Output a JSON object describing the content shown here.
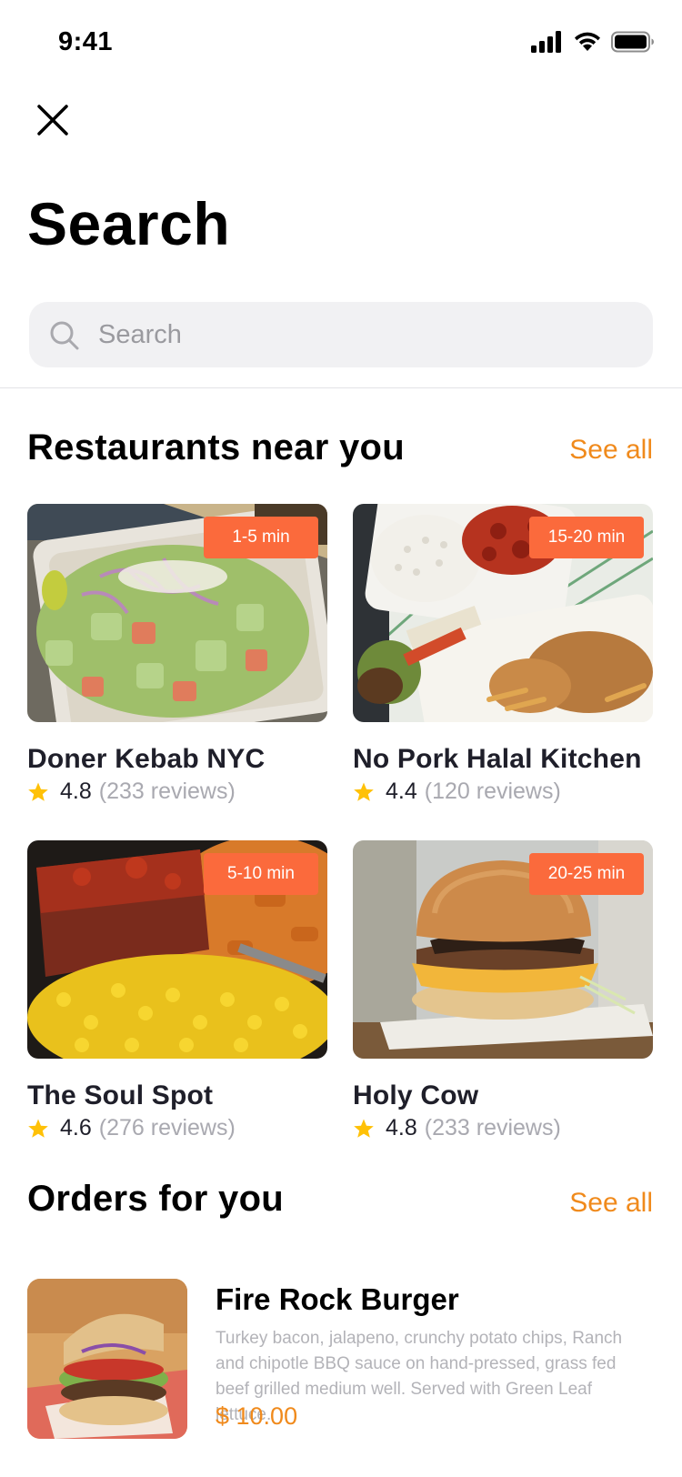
{
  "status_bar": {
    "time": "9:41"
  },
  "header": {
    "title": "Search"
  },
  "search": {
    "placeholder": "Search"
  },
  "restaurants": {
    "heading": "Restaurants near you",
    "see_all": "See all",
    "items": [
      {
        "name": "Doner Kebab NYC",
        "rating": "4.8",
        "reviews": "(233 reviews)",
        "eta": "1-5 min",
        "image": "salad-photo"
      },
      {
        "name": "No Pork Halal Kitchen",
        "rating": "4.4",
        "reviews": "(120 reviews)",
        "eta": "15-20 min",
        "image": "halal-platter-photo"
      },
      {
        "name": "The Soul Spot",
        "rating": "4.6",
        "reviews": "(276 reviews)",
        "eta": "5-10 min",
        "image": "meatloaf-corn-photo"
      },
      {
        "name": "Holy Cow",
        "rating": "4.8",
        "reviews": "(233 reviews)",
        "eta": "20-25 min",
        "image": "burger-photo"
      }
    ]
  },
  "orders": {
    "heading": "Orders for you",
    "see_all": "See all",
    "items": [
      {
        "title": "Fire Rock Burger",
        "description": "Turkey bacon, jalapeno, crunchy potato chips, Ranch and chipotle BBQ sauce on hand-pressed, grass fed beef grilled medium well. Served with Green Leaf lettuce.",
        "price": "$ 10.00",
        "image": "fire-rock-burger-photo"
      }
    ]
  },
  "colors": {
    "accent": "#f08a1c",
    "badge": "#fb6a3c",
    "star": "#ffc107",
    "search_bg": "#f1f1f3"
  }
}
